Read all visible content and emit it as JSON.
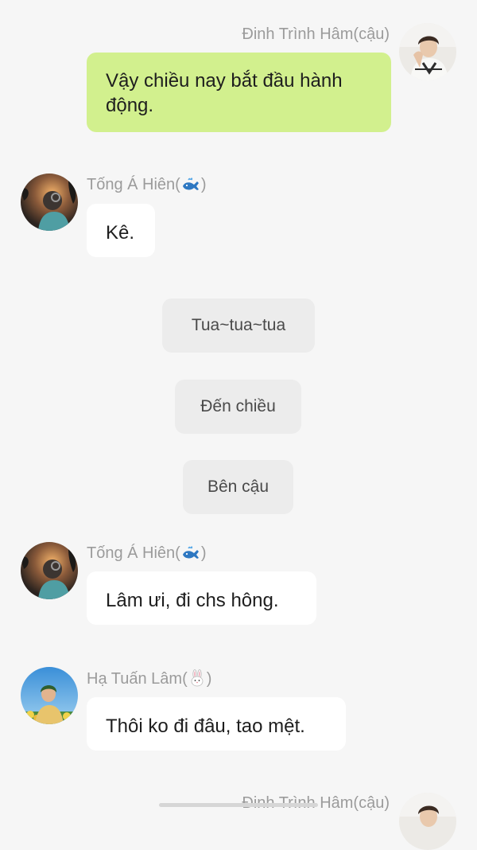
{
  "messages": [
    {
      "sender": "Đinh Trình Hâm(cậu)",
      "text": "Vậy chiều nay bắt đầu hành động."
    },
    {
      "sender_name": "Tống Á Hiên",
      "sender_emoji": "whale-icon",
      "text": "Kê."
    },
    {
      "sender_name": "Tống Á Hiên",
      "sender_emoji": "whale-icon",
      "text": "Lâm ưi, đi chs hông."
    },
    {
      "sender_name": "Hạ Tuấn Lâm",
      "sender_emoji": "rabbit-icon",
      "text": "Thôi ko đi đâu, tao mệt."
    },
    {
      "sender": "Đinh Trình Hâm(cậu)"
    }
  ],
  "system_notes": [
    "Tua~tua~tua",
    "Đến chiều",
    "Bên cậu"
  ],
  "colors": {
    "background": "#f6f6f6",
    "own_bubble": "#d2f08e",
    "other_bubble": "#ffffff",
    "system_pill": "#ececec",
    "sender_name": "#9b9b9b"
  }
}
